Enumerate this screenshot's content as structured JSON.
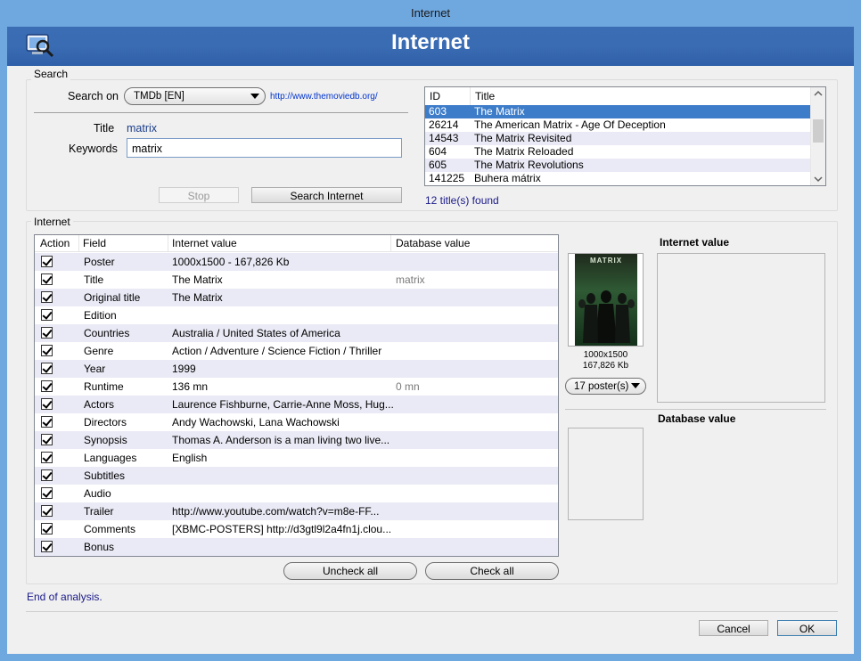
{
  "window": {
    "title": "Internet"
  },
  "header": {
    "title": "Internet",
    "icon": "magnifier-monitor-icon"
  },
  "search": {
    "group_label": "Search",
    "search_on_label": "Search on",
    "source_value": "TMDb [EN]",
    "source_url": "http://www.themoviedb.org/",
    "title_label": "Title",
    "title_value": "matrix",
    "keywords_label": "Keywords",
    "keywords_value": "matrix",
    "stop_label": "Stop",
    "search_label": "Search Internet"
  },
  "results": {
    "columns": [
      "ID",
      "Title"
    ],
    "rows": [
      {
        "id": "603",
        "title": "The Matrix",
        "selected": true
      },
      {
        "id": "26214",
        "title": "The American Matrix - Age Of Deception"
      },
      {
        "id": "14543",
        "title": "The Matrix Revisited"
      },
      {
        "id": "604",
        "title": "The Matrix Reloaded"
      },
      {
        "id": "605",
        "title": "The Matrix Revolutions"
      },
      {
        "id": "141225",
        "title": "Buhera mátrix"
      }
    ],
    "found_text": "12 title(s) found"
  },
  "internet": {
    "group_label": "Internet",
    "columns": [
      "Action",
      "Field",
      "Internet value",
      "Database value"
    ],
    "rows": [
      {
        "checked": true,
        "field": "Poster",
        "internet": "1000x1500 - 167,826 Kb",
        "database": ""
      },
      {
        "checked": true,
        "field": "Title",
        "internet": "The Matrix",
        "database": "matrix"
      },
      {
        "checked": true,
        "field": "Original title",
        "internet": "The Matrix",
        "database": ""
      },
      {
        "checked": true,
        "field": "Edition",
        "internet": "",
        "database": ""
      },
      {
        "checked": true,
        "field": "Countries",
        "internet": "Australia / United States of America",
        "database": ""
      },
      {
        "checked": true,
        "field": "Genre",
        "internet": "Action / Adventure / Science Fiction / Thriller",
        "database": ""
      },
      {
        "checked": true,
        "field": "Year",
        "internet": "1999",
        "database": ""
      },
      {
        "checked": true,
        "field": "Runtime",
        "internet": "136 mn",
        "database": "0 mn"
      },
      {
        "checked": true,
        "field": "Actors",
        "internet": "Laurence Fishburne, Carrie-Anne Moss, Hug...",
        "database": ""
      },
      {
        "checked": true,
        "field": "Directors",
        "internet": "Andy Wachowski, Lana Wachowski",
        "database": ""
      },
      {
        "checked": true,
        "field": "Synopsis",
        "internet": "Thomas A. Anderson is a man living two live...",
        "database": ""
      },
      {
        "checked": true,
        "field": "Languages",
        "internet": "English",
        "database": ""
      },
      {
        "checked": true,
        "field": "Subtitles",
        "internet": "",
        "database": ""
      },
      {
        "checked": true,
        "field": "Audio",
        "internet": "",
        "database": ""
      },
      {
        "checked": true,
        "field": "Trailer",
        "internet": "http://www.youtube.com/watch?v=m8e-FF...",
        "database": ""
      },
      {
        "checked": true,
        "field": "Comments",
        "internet": " [XBMC-POSTERS] http://d3gtl9l2a4fn1j.clou...",
        "database": ""
      },
      {
        "checked": true,
        "field": "Bonus",
        "internet": "",
        "database": ""
      }
    ],
    "uncheck_all": "Uncheck all",
    "check_all": "Check all"
  },
  "poster": {
    "image_text": "MATRIX",
    "size": "1000x1500",
    "weight": "167,826 Kb",
    "count_label": "17 poster(s)"
  },
  "side": {
    "internet_value_label": "Internet value",
    "database_value_label": "Database value"
  },
  "status": "End of analysis.",
  "footer": {
    "cancel": "Cancel",
    "ok": "OK"
  }
}
